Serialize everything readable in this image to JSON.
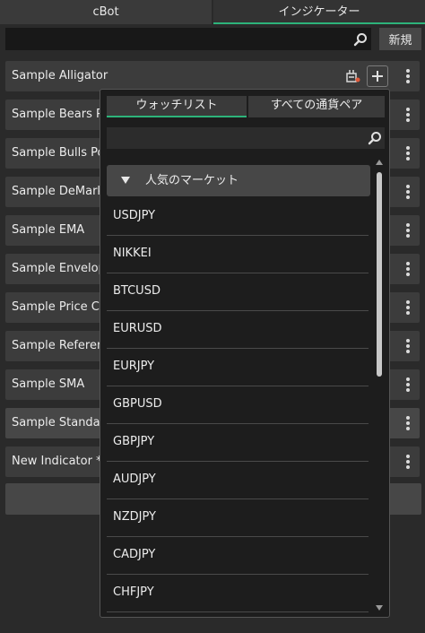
{
  "tabs": [
    "cBot",
    "インジケーター"
  ],
  "search": {
    "value": "",
    "placeholder": ""
  },
  "new_button": "新規",
  "indicators": [
    {
      "label": "Sample Alligator"
    },
    {
      "label": "Sample Bears Po"
    },
    {
      "label": "Sample Bulls Po"
    },
    {
      "label": "Sample DeMarke"
    },
    {
      "label": "Sample EMA"
    },
    {
      "label": "Sample Envelope"
    },
    {
      "label": "Sample Price Ch"
    },
    {
      "label": "Sample Referenc"
    },
    {
      "label": "Sample SMA"
    },
    {
      "label": "Sample Standard"
    },
    {
      "label": "New Indicator  *"
    }
  ],
  "popup": {
    "tabs": [
      "ウォッチリスト",
      "すべての通貨ペア"
    ],
    "search": {
      "value": "",
      "placeholder": ""
    },
    "group": "人気のマーケット",
    "symbols": [
      "USDJPY",
      "NIKKEI",
      "BTCUSD",
      "EURUSD",
      "EURJPY",
      "GBPUSD",
      "GBPJPY",
      "AUDJPY",
      "NZDJPY",
      "CADJPY",
      "CHFJPY"
    ]
  },
  "colors": {
    "accent": "#2db37a",
    "bot_icon_accent": "#e05a3c"
  },
  "icons": {
    "search": "search-icon",
    "more": "more-vert-icon",
    "add": "plus-icon",
    "bot": "bot-icon"
  }
}
